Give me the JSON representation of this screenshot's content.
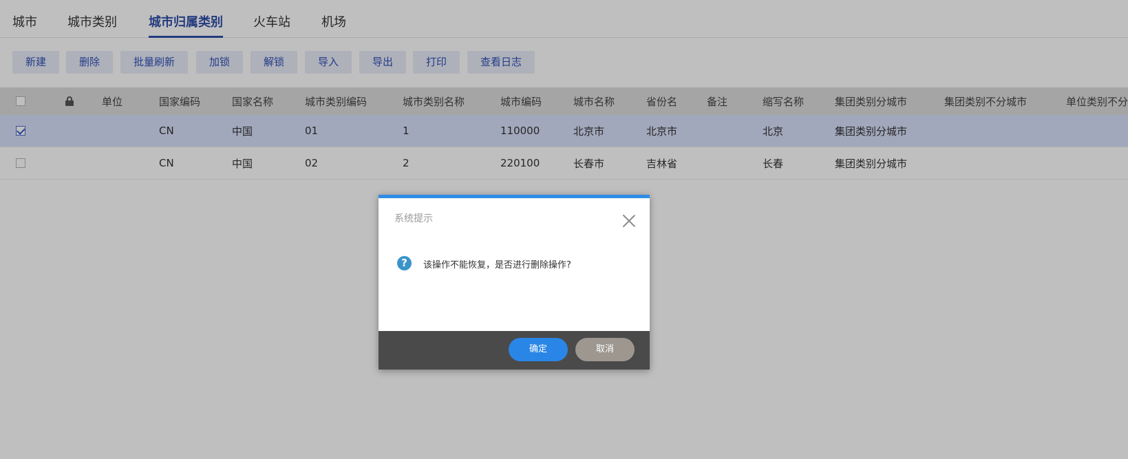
{
  "tabs": [
    {
      "label": "城市"
    },
    {
      "label": "城市类别"
    },
    {
      "label": "城市归属类别"
    },
    {
      "label": "火车站"
    },
    {
      "label": "机场"
    }
  ],
  "toolbar": {
    "new": "新建",
    "delete": "删除",
    "batch_refresh": "批量刷新",
    "lock": "加锁",
    "unlock": "解锁",
    "import": "导入",
    "export": "导出",
    "print": "打印",
    "view_log": "查看日志"
  },
  "table": {
    "headers": {
      "unit": "单位",
      "country_code": "国家编码",
      "country_name": "国家名称",
      "city_type_code": "城市类别编码",
      "city_type_name": "城市类别名称",
      "city_code": "城市编码",
      "city_name": "城市名称",
      "province": "省份名",
      "remark": "备注",
      "abbr": "缩写名称",
      "group_type_split": "集团类别分城市",
      "group_type_nosplit": "集团类别不分城市",
      "unit_type_nosplit": "单位类别不分"
    },
    "rows": [
      {
        "checked": true,
        "country_code": "CN",
        "country_name": "中国",
        "city_type_code": "01",
        "city_type_name": "1",
        "city_code": "110000",
        "city_name": "北京市",
        "province": "北京市",
        "remark": "",
        "abbr": "北京",
        "group_type_split": "集团类别分城市"
      },
      {
        "checked": false,
        "country_code": "CN",
        "country_name": "中国",
        "city_type_code": "02",
        "city_type_name": "2",
        "city_code": "220100",
        "city_name": "长春市",
        "province": "吉林省",
        "remark": "",
        "abbr": "长春",
        "group_type_split": "集团类别分城市"
      }
    ]
  },
  "dialog": {
    "title": "系统提示",
    "message": "该操作不能恢复，是否进行删除操作?",
    "icon_glyph": "?",
    "ok": "确定",
    "cancel": "取消"
  }
}
